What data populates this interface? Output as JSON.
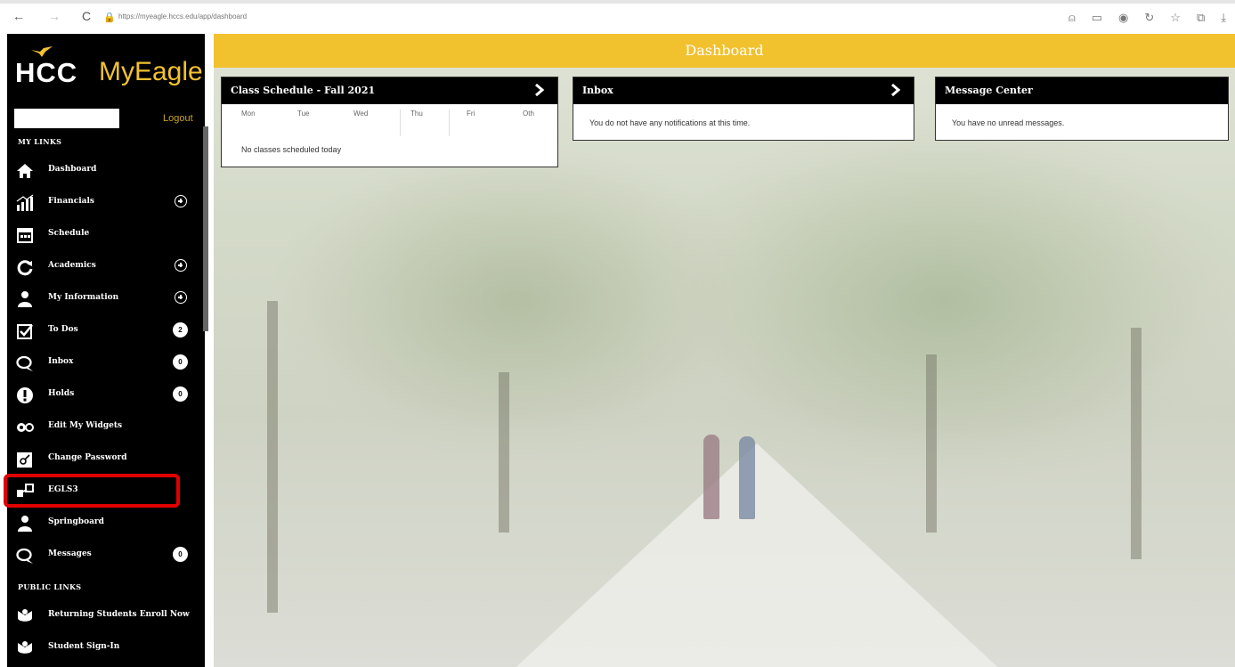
{
  "browser": {
    "back": "←",
    "forward": "→",
    "reload": "C",
    "url": "https://myeagle.hccs.edu/app/dashboard"
  },
  "sidebar": {
    "logo_hcc": "HCC",
    "logo_myeagle": "MyEagle",
    "logout": "Logout",
    "my_links_title": "MY LINKS",
    "public_links_title": "PUBLIC LINKS",
    "items": [
      {
        "label": "Dashboard",
        "icon": "home-icon"
      },
      {
        "label": "Financials",
        "icon": "chart-icon"
      },
      {
        "label": "Schedule",
        "icon": "calendar-icon"
      },
      {
        "label": "Academics",
        "icon": "refresh-icon"
      },
      {
        "label": "My Information",
        "icon": "person-icon"
      },
      {
        "label": "To Dos",
        "icon": "checkbox-icon",
        "badge": "2"
      },
      {
        "label": "Inbox",
        "icon": "chat-icon",
        "badge": "0"
      },
      {
        "label": "Holds",
        "icon": "alert-icon",
        "badge": "0"
      },
      {
        "label": "Edit My Widgets",
        "icon": "gears-icon"
      },
      {
        "label": "Change Password",
        "icon": "password-icon"
      },
      {
        "label": "EGLS3",
        "icon": "egls-icon"
      },
      {
        "label": "Springboard",
        "icon": "person-icon"
      },
      {
        "label": "Messages",
        "icon": "chat-icon",
        "badge": "0"
      }
    ],
    "public_items": [
      {
        "label": "Returning Students Enroll Now",
        "icon": "student-icon"
      },
      {
        "label": "Student Sign-In",
        "icon": "student-icon"
      }
    ]
  },
  "main": {
    "title": "Dashboard",
    "schedule": {
      "title": "Class Schedule - Fall 2021",
      "days": [
        "Mon",
        "Tue",
        "Wed",
        "Thu",
        "Fri",
        "Oth"
      ],
      "message": "No classes scheduled today"
    },
    "inbox": {
      "title": "Inbox",
      "message": "You do not have any notifications at this time."
    },
    "messages": {
      "title": "Message Center",
      "message": "You have no unread messages."
    }
  },
  "colors": {
    "accent": "#f2c12e",
    "sidebar": "#000000",
    "highlight": "#e00000"
  }
}
